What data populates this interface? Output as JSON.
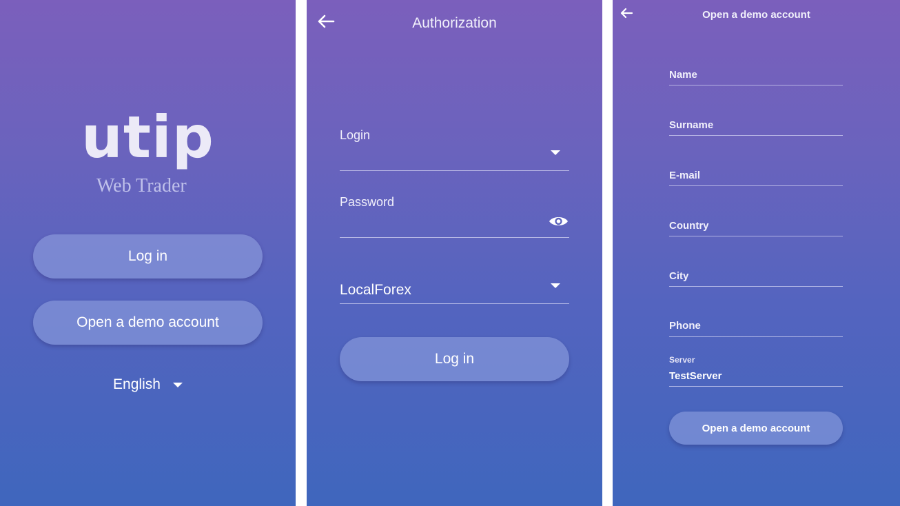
{
  "screen1": {
    "logo": "utip",
    "tagline": "Web Trader",
    "login_button": "Log in",
    "demo_button": "Open a demo account",
    "language": "English"
  },
  "screen2": {
    "title": "Authorization",
    "login_label": "Login",
    "password_label": "Password",
    "server_value": "LocalForex",
    "login_button": "Log in"
  },
  "screen3": {
    "title": "Open a demo account",
    "fields": {
      "name": "Name",
      "surname": "Surname",
      "email": "E-mail",
      "country": "Country",
      "city": "City",
      "phone": "Phone"
    },
    "server_label": "Server",
    "server_value": "TestServer",
    "submit_button": "Open a demo account"
  },
  "icons": {
    "back": "arrow-left-icon",
    "dropdown": "caret-down-icon",
    "password_visibility": "eye-icon"
  },
  "colors": {
    "gradient_top": "#7b5fbc",
    "gradient_bottom": "#3f66bd",
    "button_fill": "#96a5e1"
  }
}
